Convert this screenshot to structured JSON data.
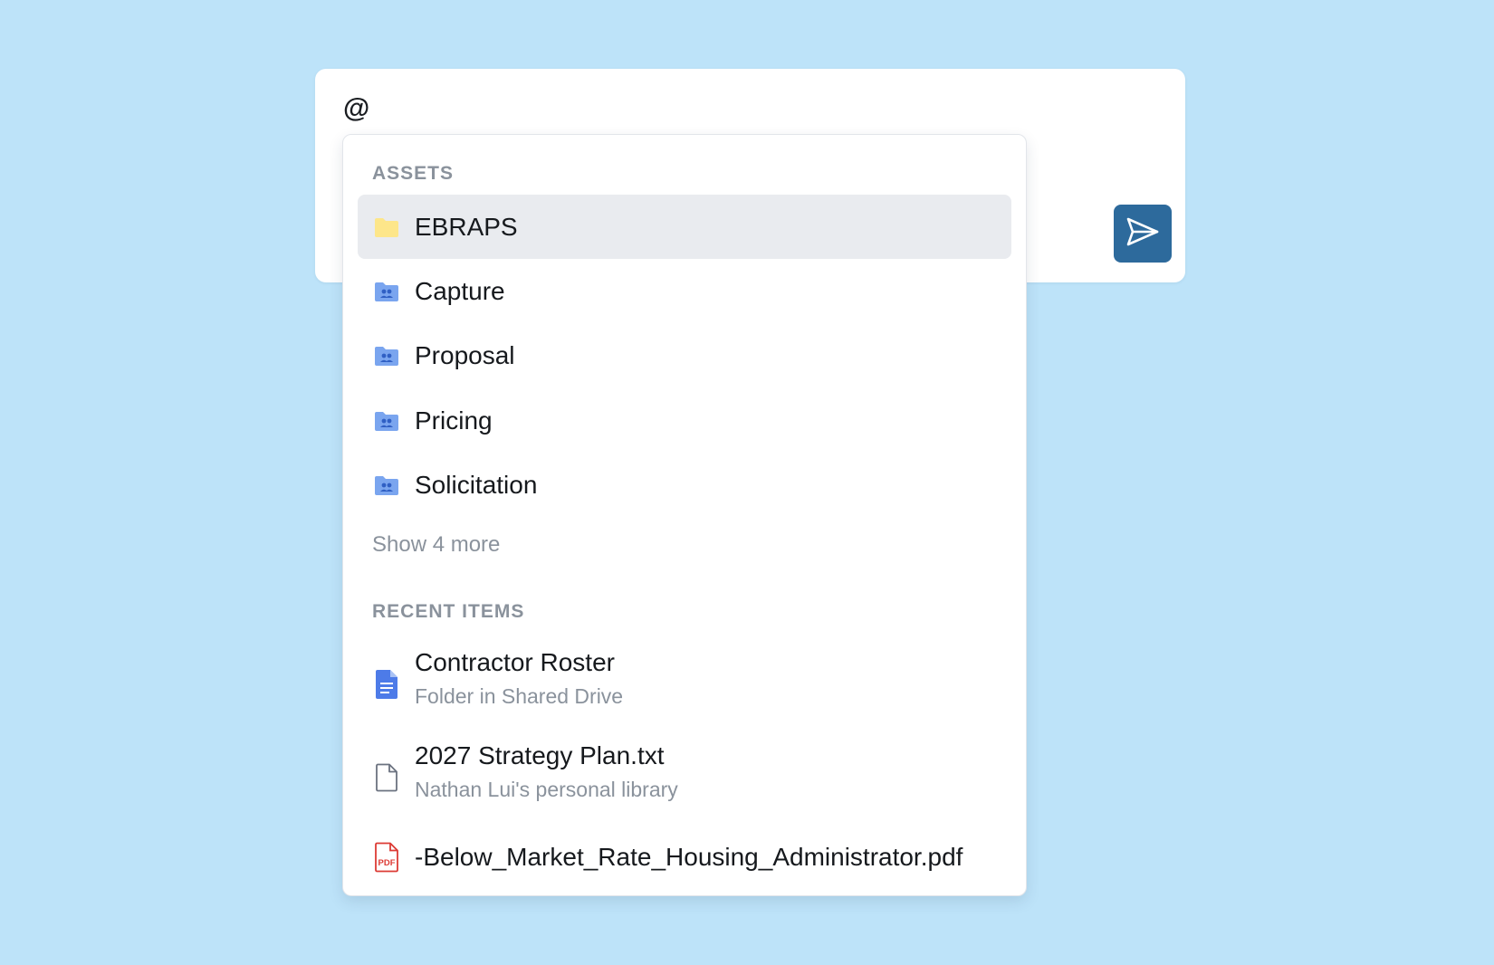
{
  "composer": {
    "input_text": "@",
    "send_icon": "send-icon",
    "send_color": "#2d6a9c"
  },
  "dropdown": {
    "assets": {
      "heading": "ASSETS",
      "items": [
        {
          "label": "EBRAPS",
          "icon": "folder-icon",
          "selected": true
        },
        {
          "label": "Capture",
          "icon": "shared-folder-icon",
          "selected": false
        },
        {
          "label": "Proposal",
          "icon": "shared-folder-icon",
          "selected": false
        },
        {
          "label": "Pricing",
          "icon": "shared-folder-icon",
          "selected": false
        },
        {
          "label": "Solicitation",
          "icon": "shared-folder-icon",
          "selected": false
        }
      ],
      "show_more": "Show 4 more"
    },
    "recent": {
      "heading": "RECENT ITEMS",
      "items": [
        {
          "title": "Contractor Roster",
          "subtitle": "Folder in Shared Drive",
          "icon": "google-doc-icon"
        },
        {
          "title": "2027 Strategy Plan.txt",
          "subtitle": "Nathan Lui's personal library",
          "icon": "file-icon"
        },
        {
          "title": "-Below_Market_Rate_Housing_Administrator.pdf",
          "subtitle": "",
          "icon": "pdf-icon"
        }
      ]
    }
  },
  "colors": {
    "background": "#bde3f9",
    "selected_row": "#e9ebef",
    "folder_yellow": "#fde68a",
    "folder_blue": "#7aa5ef",
    "doc_blue": "#4d7be8",
    "pdf_red": "#dc3b35",
    "muted_text": "#8a929c"
  }
}
